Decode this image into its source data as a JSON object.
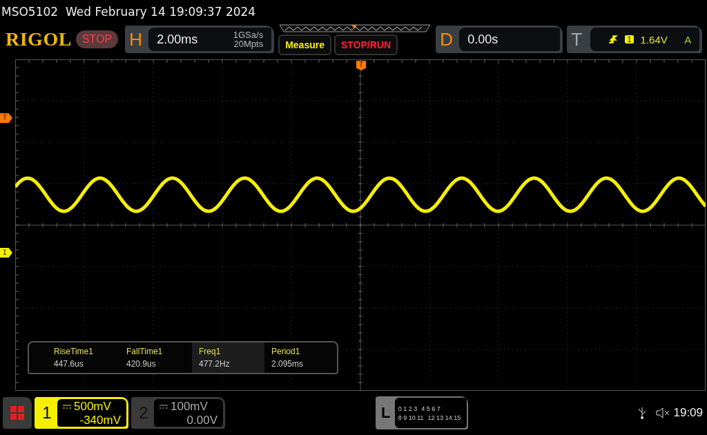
{
  "status_line": "MSO5102  Wed February 14 19:09:37 2024",
  "logo": "RIGOL",
  "run_state": {
    "label": "STOP"
  },
  "horizontal": {
    "letter": "H",
    "timebase": "2.00ms",
    "sample_rate": "1GSa/s",
    "memory_depth": "20Mpts"
  },
  "buttons": [
    {
      "label": "Measure",
      "kind": "measure"
    },
    {
      "label": "STOP/RUN",
      "kind": "stoprun"
    }
  ],
  "delay": {
    "letter": "D",
    "value": "0.00s"
  },
  "trigger": {
    "letter": "T",
    "source": "1",
    "level": "1.64V",
    "mode": "A"
  },
  "top_marker": "T",
  "markers": [
    {
      "label": "T",
      "kind": "trigger"
    },
    {
      "label": "1",
      "kind": "channel"
    }
  ],
  "measurements": [
    {
      "name": "RiseTime1",
      "value": "447.6us",
      "selected": false
    },
    {
      "name": "FallTime1",
      "value": "420.9us",
      "selected": false
    },
    {
      "name": "Freq1",
      "value": "477.2Hz",
      "selected": true
    },
    {
      "name": "Period1",
      "value": "2.095ms",
      "selected": false
    }
  ],
  "channels": [
    {
      "number": "1",
      "scale": "500mV",
      "offset": "-340mV",
      "selected": true
    },
    {
      "number": "2",
      "scale": "100mV",
      "offset": "0.00V",
      "selected": false
    }
  ],
  "logic": {
    "letter": "L",
    "row_1": [
      "0 1 2 3",
      "4 5 6 7"
    ],
    "row_2": [
      "8 9 10 11",
      "12 13 14 15"
    ]
  },
  "clock": "19:09"
}
